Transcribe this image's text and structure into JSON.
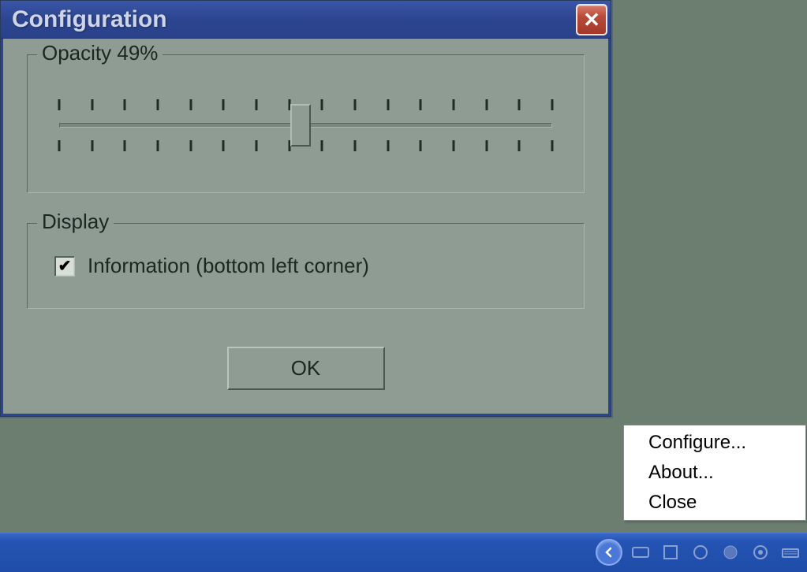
{
  "dialog": {
    "title": "Configuration",
    "opacity": {
      "label": "Opacity 49%",
      "value": 49,
      "tick_count": 16
    },
    "display": {
      "label": "Display",
      "checkbox_label": "Information (bottom left corner)",
      "checked": true
    },
    "ok_label": "OK"
  },
  "context_menu": {
    "items": [
      "Configure...",
      "About...",
      "Close"
    ]
  }
}
